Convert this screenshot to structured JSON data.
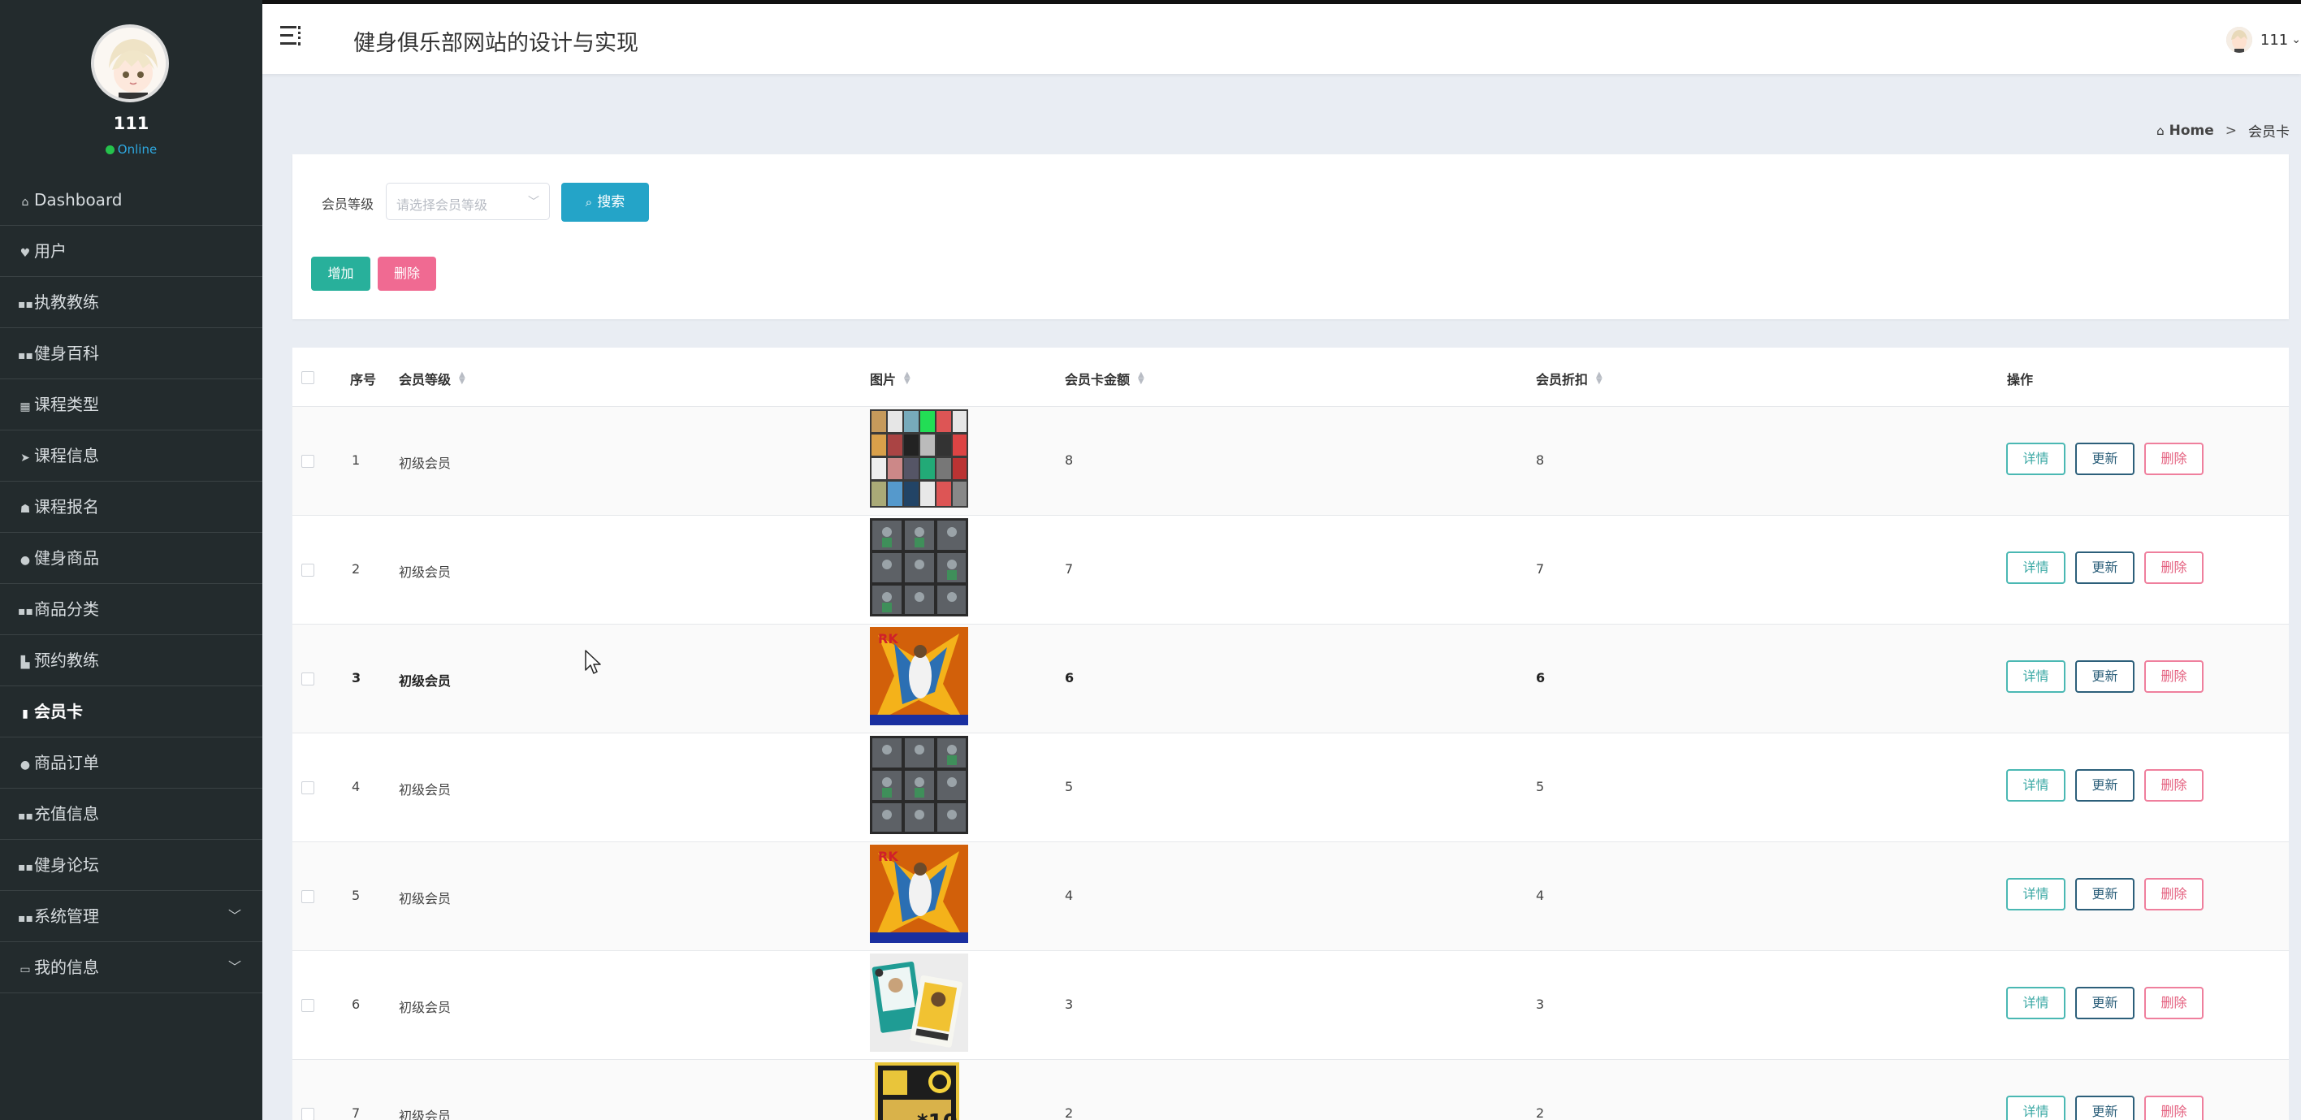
{
  "sidebar": {
    "profile": {
      "name": "111",
      "status": "Online"
    },
    "items": [
      {
        "label": "Dashboard",
        "icon": "home-icon"
      },
      {
        "label": "用户",
        "icon": "user-icon"
      },
      {
        "label": "执教教练",
        "icon": "grid-icon"
      },
      {
        "label": "健身百科",
        "icon": "grid-icon"
      },
      {
        "label": "课程类型",
        "icon": "grid-icon"
      },
      {
        "label": "课程信息",
        "icon": "send-icon"
      },
      {
        "label": "课程报名",
        "icon": "inbox-icon"
      },
      {
        "label": "健身商品",
        "icon": "user-icon"
      },
      {
        "label": "商品分类",
        "icon": "grid-icon"
      },
      {
        "label": "预约教练",
        "icon": "chart-icon"
      },
      {
        "label": "会员卡",
        "icon": "card-icon"
      },
      {
        "label": "商品订单",
        "icon": "pin-icon"
      },
      {
        "label": "充值信息",
        "icon": "grid-icon"
      },
      {
        "label": "健身论坛",
        "icon": "grid-icon"
      },
      {
        "label": "系统管理",
        "icon": "grid-icon"
      },
      {
        "label": "我的信息",
        "icon": "folder-icon"
      }
    ]
  },
  "header": {
    "title": "健身俱乐部网站的设计与实现",
    "user": "111"
  },
  "breadcrumb": {
    "home": "Home",
    "separator": ">",
    "current": "会员卡"
  },
  "search": {
    "label": "会员等级",
    "placeholder": "请选择会员等级",
    "button": "搜索"
  },
  "actions": {
    "add": "增加",
    "delete": "删除"
  },
  "table": {
    "columns": {
      "index": "序号",
      "level": "会员等级",
      "image": "图片",
      "amount": "会员卡金额",
      "discount": "会员折扣",
      "operation": "操作"
    },
    "row_actions": {
      "view": "详情",
      "update": "更新",
      "delete": "删除"
    },
    "rows": [
      {
        "index": "1",
        "level": "初级会员",
        "amount": "8",
        "discount": "8"
      },
      {
        "index": "2",
        "level": "初级会员",
        "amount": "7",
        "discount": "7"
      },
      {
        "index": "3",
        "level": "初级会员",
        "amount": "6",
        "discount": "6"
      },
      {
        "index": "4",
        "level": "初级会员",
        "amount": "5",
        "discount": "5"
      },
      {
        "index": "5",
        "level": "初级会员",
        "amount": "4",
        "discount": "4"
      },
      {
        "index": "6",
        "level": "初级会员",
        "amount": "3",
        "discount": "3"
      },
      {
        "index": "7",
        "level": "初级会员",
        "amount": "2",
        "discount": "2"
      }
    ]
  },
  "colors": {
    "sidebar_bg": "#232b2d",
    "search_button": "#24a4c8",
    "add_button": "#28b09b",
    "delete_button": "#f06a92"
  }
}
